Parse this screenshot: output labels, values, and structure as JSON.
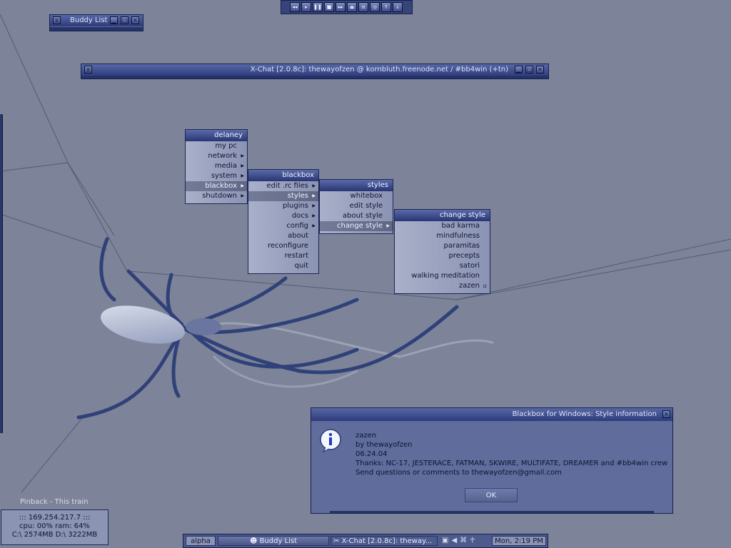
{
  "wallpaper": {
    "colors": {
      "base": "#7d8499",
      "spider": "#2f4178",
      "spider_light": "#d4dae8"
    }
  },
  "buddy_window": {
    "title": "Buddy List"
  },
  "xchat_window": {
    "title": "X-Chat [2.0.8c]: thewayofzen @ kornbluth.freenode.net / #bb4win (+tn)"
  },
  "media_toolbar": {
    "buttons": [
      {
        "name": "rewind-icon",
        "glyph": "◂◂"
      },
      {
        "name": "play-icon",
        "glyph": "▸"
      },
      {
        "name": "pause-icon",
        "glyph": "❚❚"
      },
      {
        "name": "stop-icon",
        "glyph": "■"
      },
      {
        "name": "forward-icon",
        "glyph": "▸▸"
      },
      {
        "name": "eject-icon",
        "glyph": "⏏"
      },
      {
        "name": "playlist-icon",
        "glyph": "≡"
      },
      {
        "name": "target-icon",
        "glyph": "◎"
      },
      {
        "name": "up-icon",
        "glyph": "↑"
      },
      {
        "name": "down-icon",
        "glyph": "↓"
      }
    ]
  },
  "menus": {
    "root": {
      "title": "delaney",
      "items": [
        {
          "label": "my pc",
          "submenu": false,
          "selected": false
        },
        {
          "label": "network",
          "submenu": true,
          "selected": false
        },
        {
          "label": "media",
          "submenu": true,
          "selected": false
        },
        {
          "label": "system",
          "submenu": true,
          "selected": false
        },
        {
          "label": "blackbox",
          "submenu": true,
          "selected": true
        },
        {
          "label": "shutdown",
          "submenu": true,
          "selected": false
        }
      ]
    },
    "blackbox": {
      "title": "blackbox",
      "items": [
        {
          "label": "edit .rc files",
          "submenu": true,
          "selected": false
        },
        {
          "label": "styles",
          "submenu": true,
          "selected": true
        },
        {
          "label": "plugins",
          "submenu": true,
          "selected": false
        },
        {
          "label": "docs",
          "submenu": true,
          "selected": false
        },
        {
          "label": "config",
          "submenu": true,
          "selected": false
        },
        {
          "label": "about",
          "submenu": false,
          "selected": false
        },
        {
          "label": "reconfigure",
          "submenu": false,
          "selected": false
        },
        {
          "label": "restart",
          "submenu": false,
          "selected": false
        },
        {
          "label": "quit",
          "submenu": false,
          "selected": false
        }
      ]
    },
    "styles": {
      "title": "styles",
      "items": [
        {
          "label": "whitebox",
          "submenu": false,
          "selected": false
        },
        {
          "label": "edit style",
          "submenu": false,
          "selected": false
        },
        {
          "label": "about style",
          "submenu": false,
          "selected": false
        },
        {
          "label": "change style",
          "submenu": true,
          "selected": true
        }
      ]
    },
    "change_style": {
      "title": "change style",
      "items": [
        {
          "label": "bad karma",
          "submenu": false,
          "selected": false
        },
        {
          "label": "mindfulness",
          "submenu": false,
          "selected": false
        },
        {
          "label": "paramitas",
          "submenu": false,
          "selected": false
        },
        {
          "label": "precepts",
          "submenu": false,
          "selected": false
        },
        {
          "label": "satori",
          "submenu": false,
          "selected": false
        },
        {
          "label": "walking meditation",
          "submenu": false,
          "selected": false
        },
        {
          "label": "zazen",
          "submenu": false,
          "selected": false,
          "checked": true
        }
      ]
    }
  },
  "dialog": {
    "title": "Blackbox for Windows: Style information",
    "lines": [
      "zazen",
      "by thewayofzen",
      "06.24.04",
      "Thanks: NC-17, JESTERACE, FATMAN, SKWIRE, MULTIFATE, DREAMER and #bb4win crew",
      "Send questions or comments to thewayofzen@gmail.com"
    ],
    "ok_label": "OK",
    "icon": "info-icon"
  },
  "now_playing": "Pinback - This train",
  "sysinfo": {
    "ip": "::: 169.254.217.7 :::",
    "cpu_ram": "cpu: 00%   ram: 64%",
    "disks": "C:\\ 2574MB  D:\\ 3222MB"
  },
  "taskbar": {
    "workspace": "alpha",
    "tasks": [
      {
        "label": "Buddy List",
        "icon": "buddy-icon",
        "active": true
      },
      {
        "label": "X-Chat [2.0.8c]: theway...",
        "icon": "xchat-icon",
        "active": false
      }
    ],
    "tray_icons": [
      "monitor-icon",
      "volume-icon",
      "network-icon",
      "user-icon"
    ],
    "clock": "Mon, 2:19 PM"
  }
}
